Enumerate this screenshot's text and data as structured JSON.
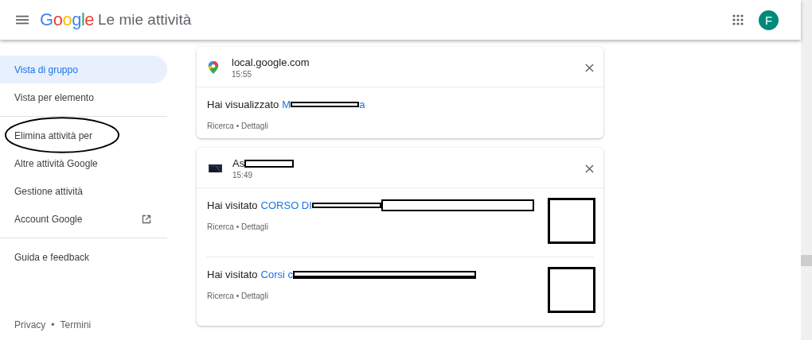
{
  "header": {
    "logo": "Google",
    "title": "Le mie attività",
    "avatar": "F"
  },
  "sidebar": {
    "groups": [
      [
        {
          "label": "Vista di gruppo",
          "selected": true
        },
        {
          "label": "Vista per elemento",
          "selected": false
        }
      ],
      [
        {
          "label": "Elimina attività per",
          "selected": false,
          "circled": true
        },
        {
          "label": "Altre attività Google",
          "selected": false
        },
        {
          "label": "Gestione attività",
          "selected": false
        },
        {
          "label": "Account Google",
          "selected": false,
          "external": true
        }
      ],
      [
        {
          "label": "Guida e feedback",
          "selected": false
        }
      ]
    ],
    "footer": [
      "Privacy",
      "•",
      "Termini"
    ]
  },
  "cards": [
    {
      "kind": "maps",
      "title": "local.google.com",
      "title_redacted": false,
      "time": "15:55",
      "items": [
        {
          "verb": "Hai visualizzato",
          "link": "M",
          "link_tail": "a",
          "meta": "Ricerca • Dettagli",
          "thumbnail": false
        }
      ]
    },
    {
      "kind": "thumb",
      "title": "As",
      "title_redacted": true,
      "time": "15:49",
      "items": [
        {
          "verb": "Hai visitato",
          "link": "CORSO DI",
          "meta": "Ricerca • Dettagli",
          "thumbnail": true
        },
        {
          "verb": "Hai visitato",
          "link": "Corsi c",
          "meta": "Ricerca • Dettagli",
          "thumbnail": true
        }
      ]
    }
  ]
}
